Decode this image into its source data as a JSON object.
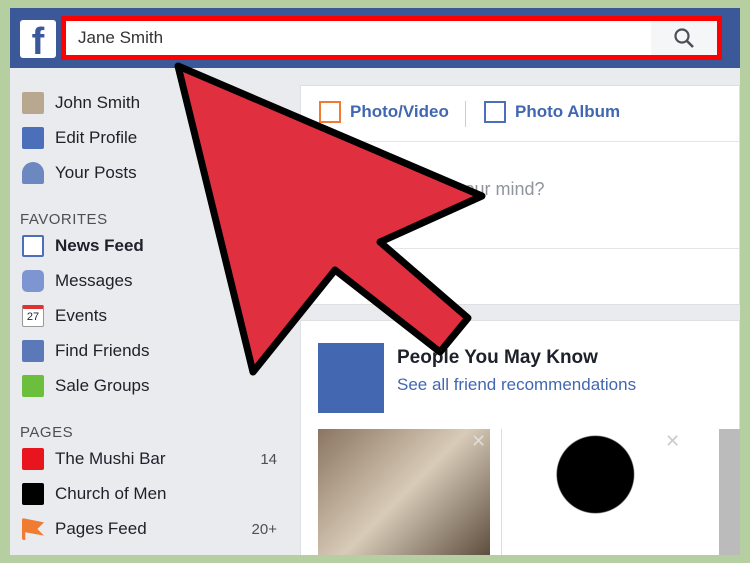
{
  "header": {
    "logo": "f",
    "search_value": "Jane Smith",
    "search_icon": "search-icon"
  },
  "sidebar": {
    "profile": [
      {
        "label": "John Smith",
        "icon": "avatar"
      },
      {
        "label": "Edit Profile",
        "icon": "pencil-icon"
      },
      {
        "label": "Your Posts",
        "icon": "person-icon"
      }
    ],
    "favorites_header": "FAVORITES",
    "favorites": [
      {
        "label": "News Feed",
        "icon": "news-feed-icon"
      },
      {
        "label": "Messages",
        "icon": "messages-icon"
      },
      {
        "label": "Events",
        "icon": "calendar-icon",
        "icon_text": "27"
      },
      {
        "label": "Find Friends",
        "icon": "friends-icon"
      },
      {
        "label": "Sale Groups",
        "icon": "tag-icon"
      }
    ],
    "pages_header": "PAGES",
    "pages": [
      {
        "label": "The Mushi Bar",
        "count": "14",
        "color": "#e8141e"
      },
      {
        "label": "Church of Men",
        "count": "",
        "color": "#000000"
      },
      {
        "label": "Pages Feed",
        "count": "20+",
        "icon": "flag-icon"
      }
    ]
  },
  "composer": {
    "photo_video": "Photo/Video",
    "photo_album": "Photo Album",
    "placeholder": "What's on your mind?"
  },
  "pymk": {
    "title": "People You May Know",
    "link": "See all friend recommendations"
  },
  "colors": {
    "facebook_blue": "#3b5998",
    "highlight": "#ff0000",
    "arrow": "#e03040",
    "background": "#b6cfa0"
  }
}
